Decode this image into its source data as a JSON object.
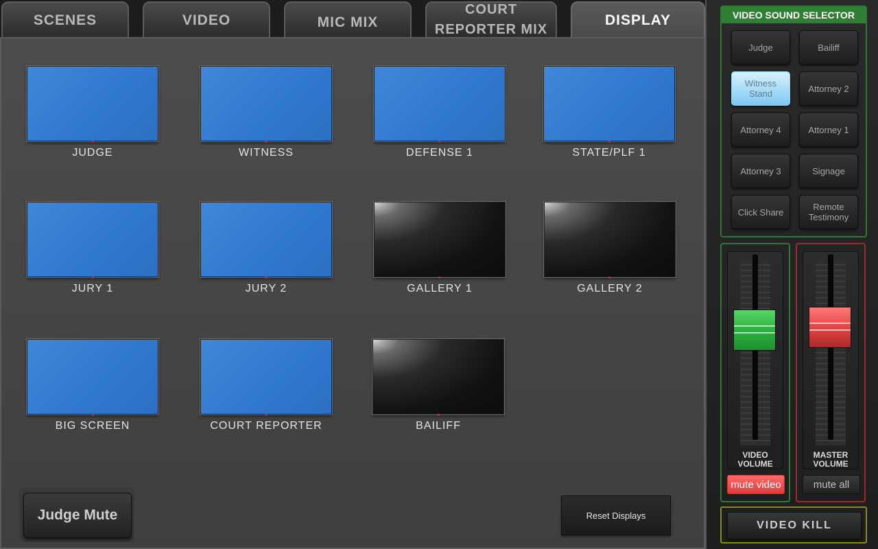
{
  "tabs": [
    {
      "label": "SCENES"
    },
    {
      "label": "VIDEO"
    },
    {
      "label": "MIC MIX"
    },
    {
      "label": "COURT\nREPORTER MIX"
    },
    {
      "label": "DISPLAY",
      "active": true
    }
  ],
  "displays": [
    {
      "label": "JUDGE",
      "state": "on"
    },
    {
      "label": "WITNESS",
      "state": "on"
    },
    {
      "label": "DEFENSE 1",
      "state": "on"
    },
    {
      "label": "STATE/PLF 1",
      "state": "on"
    },
    {
      "label": "JURY 1",
      "state": "on"
    },
    {
      "label": "JURY 2",
      "state": "on"
    },
    {
      "label": "GALLERY 1",
      "state": "off"
    },
    {
      "label": "GALLERY 2",
      "state": "off"
    },
    {
      "label": "BIG SCREEN",
      "state": "on"
    },
    {
      "label": "COURT REPORTER",
      "state": "on"
    },
    {
      "label": "BAILIFF",
      "state": "off"
    }
  ],
  "main": {
    "judge_mute_label": "Judge Mute",
    "reset_label": "Reset Displays"
  },
  "sound_selector": {
    "title": "VIDEO SOUND SELECTOR",
    "buttons": [
      {
        "label": "Judge",
        "selected": false
      },
      {
        "label": "Bailiff",
        "selected": false
      },
      {
        "label": "Witness\nStand",
        "selected": true
      },
      {
        "label": "Attorney 2",
        "selected": false
      },
      {
        "label": "Attorney 4",
        "selected": false
      },
      {
        "label": "Attorney 1",
        "selected": false
      },
      {
        "label": "Attorney 3",
        "selected": false
      },
      {
        "label": "Signage",
        "selected": false
      },
      {
        "label": "Click Share",
        "selected": false
      },
      {
        "label": "Remote\nTestimony",
        "selected": false
      }
    ]
  },
  "faders": {
    "video": {
      "label": "VIDEO\nVOLUME",
      "level": 0.62,
      "mute_label": "mute video",
      "muted": true
    },
    "master": {
      "label": "MASTER\nVOLUME",
      "level": 0.64,
      "mute_label": "mute all",
      "muted": false
    }
  },
  "video_kill_label": "VIDEO KILL",
  "colors": {
    "accent_green": "#2f7f35",
    "accent_red": "#a02a2a",
    "screen_on": "#3a82d6",
    "selected_button": "#8fd3f7"
  }
}
